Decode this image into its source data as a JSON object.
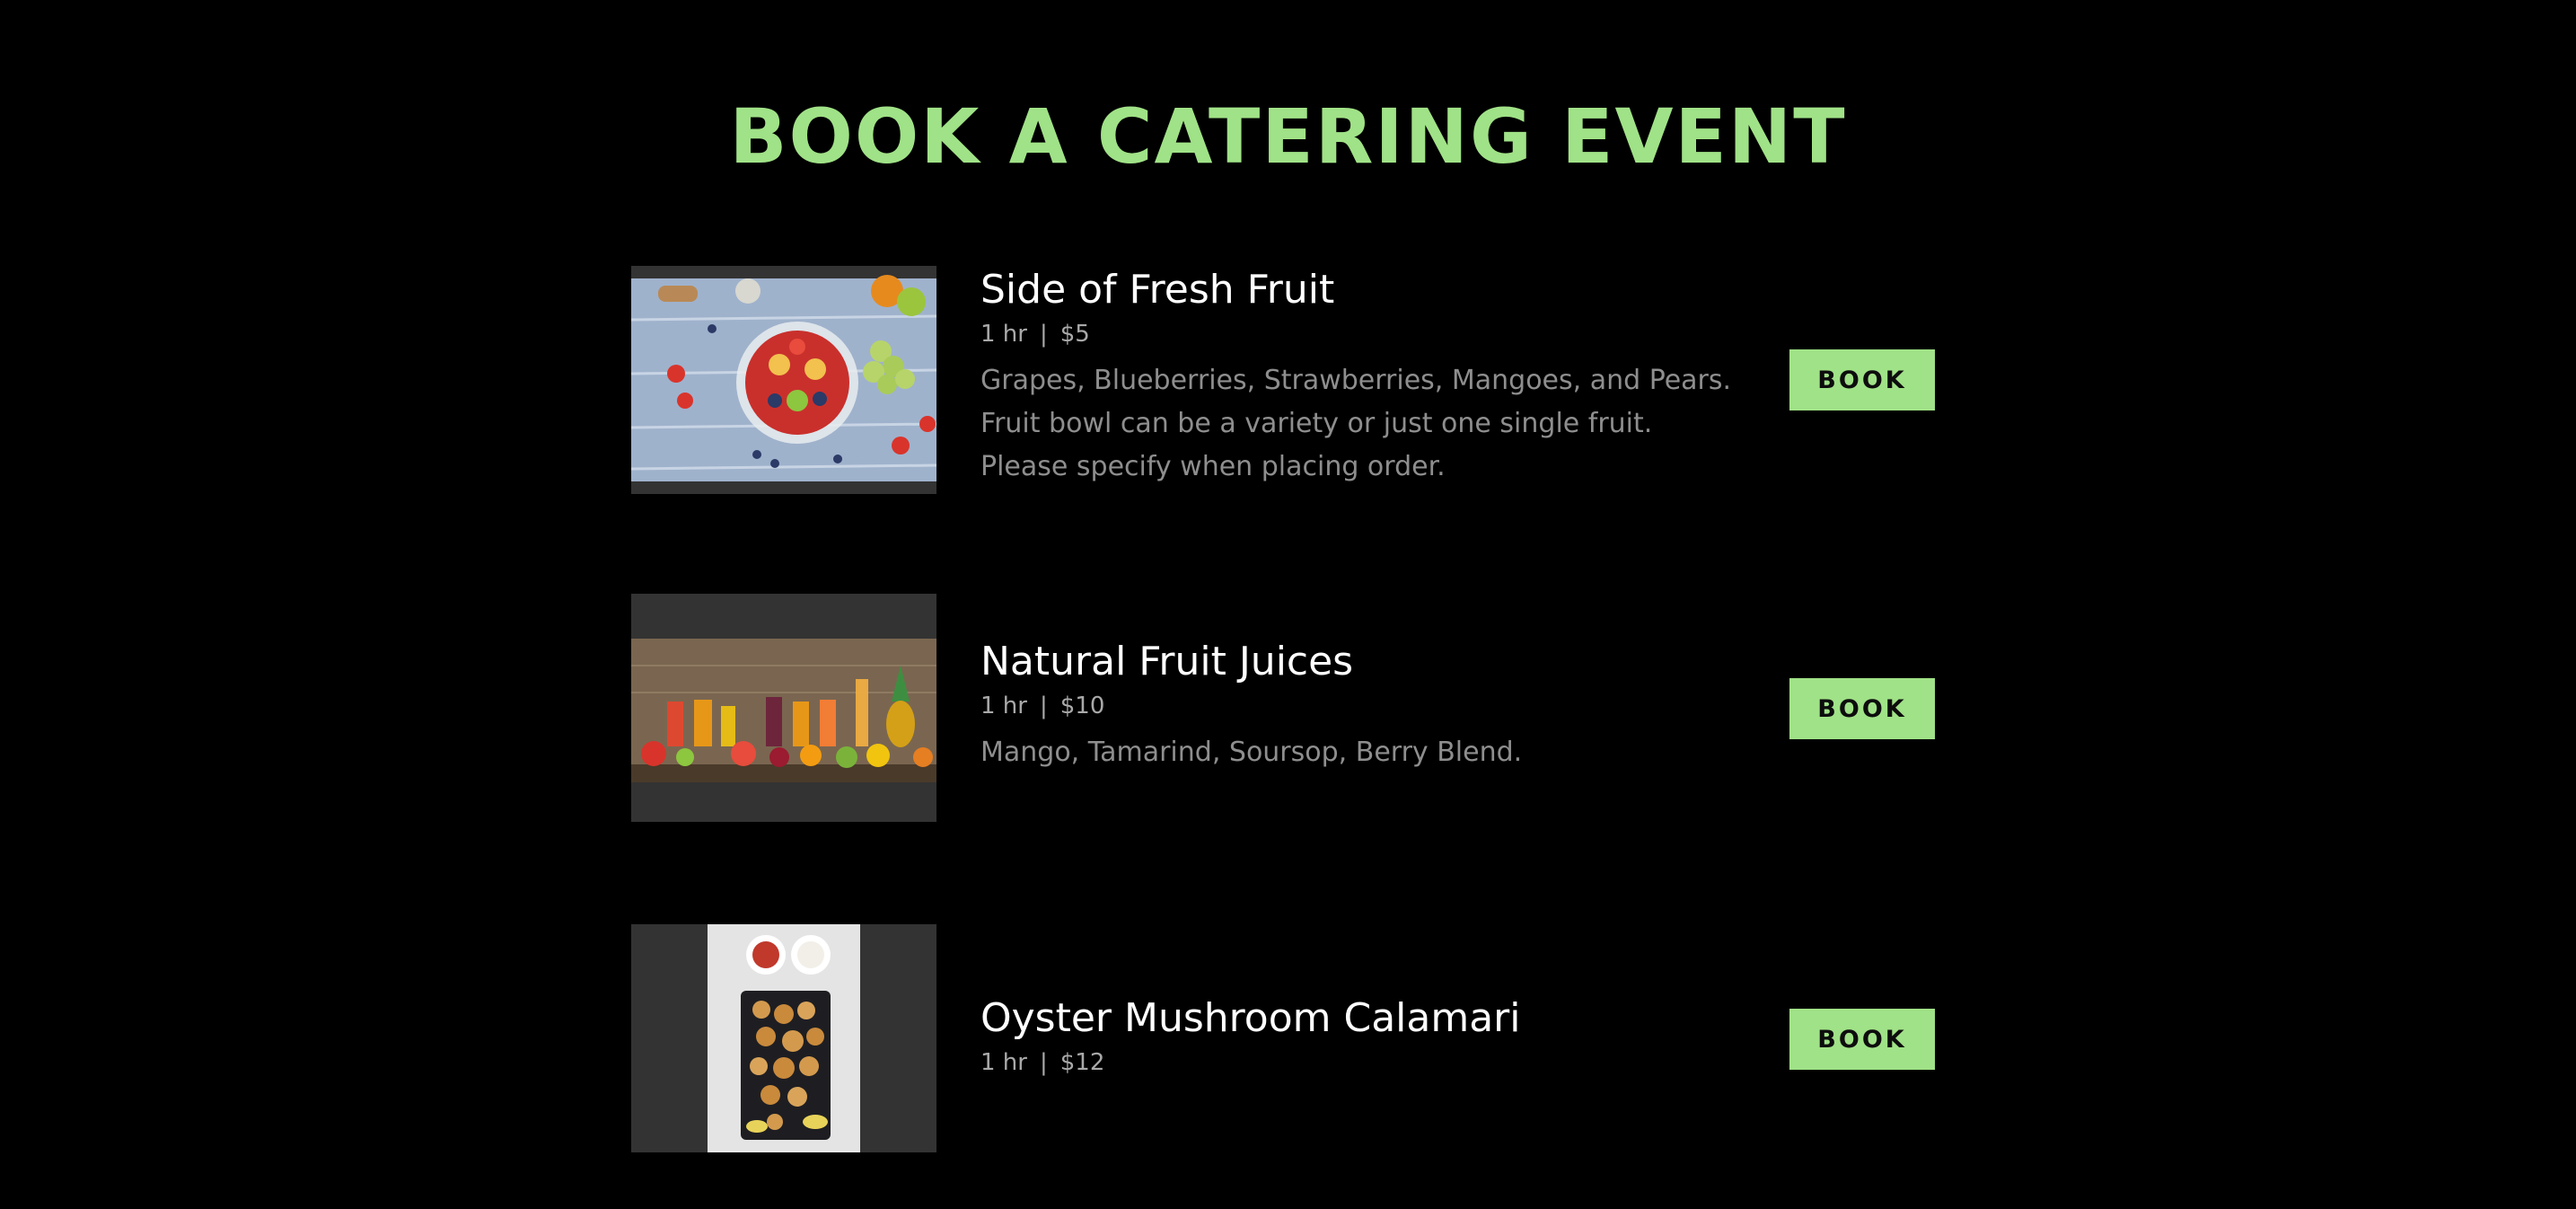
{
  "page": {
    "title": "BOOK A CATERING EVENT"
  },
  "colors": {
    "accent": "#a0e287",
    "background": "#000000",
    "thumb_background": "#333333"
  },
  "services": [
    {
      "name": "Side of Fresh Fruit",
      "duration": "1 hr",
      "price": "$5",
      "description": "Grapes, Blueberries, Strawberries, Mangoes, and Pears. Fruit bowl can be a variety or just one single fruit. Please specify when placing order.",
      "image": "fruit-bowl-photo",
      "book_label": "BOOK"
    },
    {
      "name": "Natural Fruit Juices",
      "duration": "1 hr",
      "price": "$10",
      "description": "Mango, Tamarind, Soursop, Berry Blend.",
      "image": "fruit-juices-photo",
      "book_label": "BOOK"
    },
    {
      "name": "Oyster Mushroom Calamari",
      "duration": "1 hr",
      "price": "$12",
      "description": "",
      "image": "mushroom-calamari-photo",
      "book_label": "BOOK"
    }
  ],
  "separator": "|"
}
